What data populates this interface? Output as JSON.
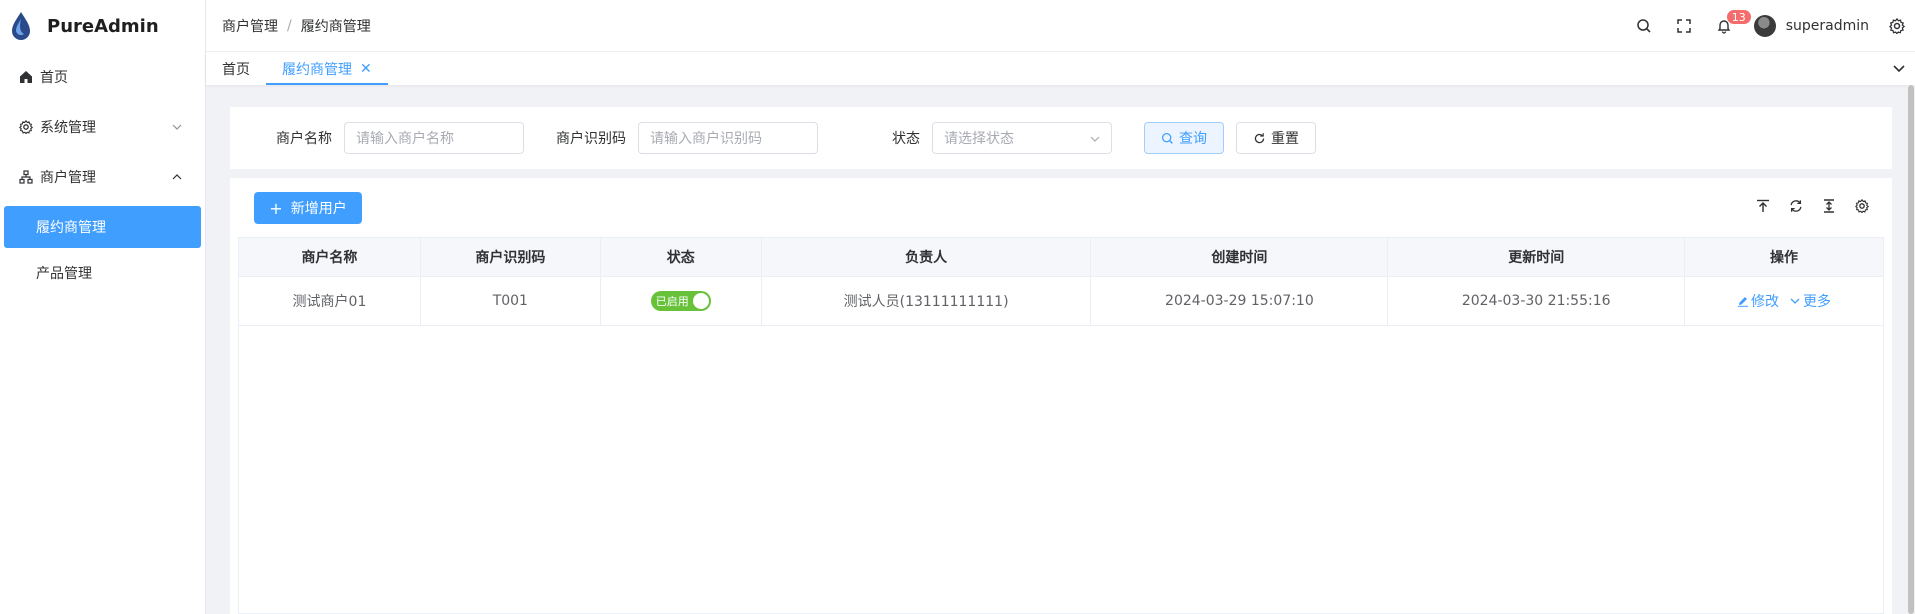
{
  "app": {
    "name": "PureAdmin",
    "accent": "#409eff"
  },
  "sidebar": {
    "items": [
      {
        "label": "首页",
        "icon": "home-icon"
      },
      {
        "label": "系统管理",
        "icon": "gear-icon",
        "expanded": false
      },
      {
        "label": "商户管理",
        "icon": "sitemap-icon",
        "expanded": true,
        "children": [
          {
            "label": "履约商管理",
            "active": true
          },
          {
            "label": "产品管理",
            "active": false
          }
        ]
      }
    ]
  },
  "header": {
    "breadcrumb": [
      "商户管理",
      "履约商管理"
    ],
    "breadcrumb_sep": "/",
    "notification_count": "13",
    "username": "superadmin"
  },
  "tabs": [
    {
      "label": "首页",
      "active": false
    },
    {
      "label": "履约商管理",
      "active": true,
      "closable": true
    }
  ],
  "search": {
    "fields": [
      {
        "label": "商户名称",
        "placeholder": "请输入商户名称"
      },
      {
        "label": "商户识别码",
        "placeholder": "请输入商户识别码"
      },
      {
        "label": "状态",
        "placeholder": "请选择状态"
      }
    ],
    "query_label": "查询",
    "reset_label": "重置"
  },
  "table": {
    "add_button": "新增用户",
    "columns": [
      "商户名称",
      "商户识别码",
      "状态",
      "负责人",
      "创建时间",
      "更新时间",
      "操作"
    ],
    "rows": [
      {
        "name": "测试商户01",
        "code": "T001",
        "status": "已启用",
        "status_on": true,
        "owner": "测试人员(13111111111)",
        "created": "2024-03-29 15:07:10",
        "updated": "2024-03-30 21:55:16",
        "edit": "修改",
        "more": "更多"
      }
    ],
    "status_color": "#67c23a"
  }
}
